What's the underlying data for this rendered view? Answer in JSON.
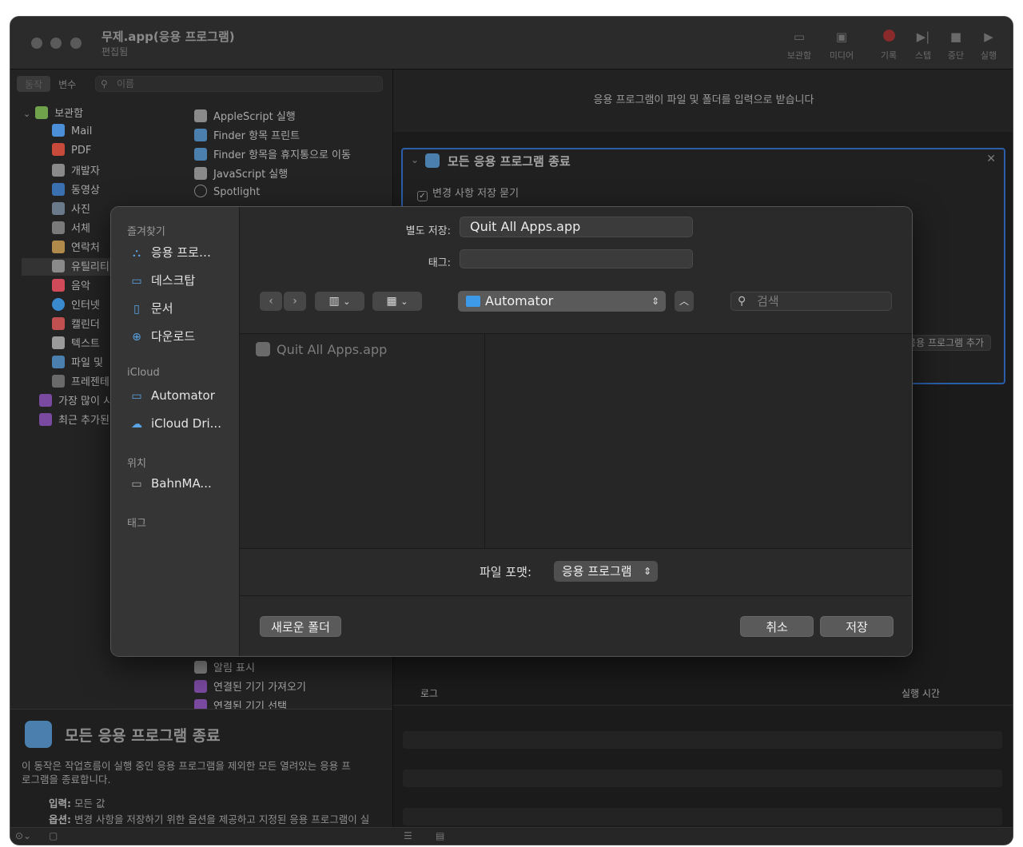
{
  "window": {
    "title": "무제.app(응용 프로그램)",
    "subtitle": "편집됨",
    "toolbar": [
      "보관함",
      "미디어",
      "기록",
      "스텝",
      "중단",
      "실행"
    ]
  },
  "library": {
    "tabs": [
      "동작",
      "변수"
    ],
    "search_placeholder": "이름",
    "items": [
      {
        "label": "보관함",
        "color": "#6fa24b"
      },
      {
        "label": "Mail",
        "color": "#4a8fd8"
      },
      {
        "label": "PDF",
        "color": "#c84a3a"
      },
      {
        "label": "개발자",
        "color": "#8a8a8a"
      },
      {
        "label": "동영상",
        "color": "#3a6fb0"
      },
      {
        "label": "사진",
        "color": "#6a7a8a"
      },
      {
        "label": "서체",
        "color": "#7a7a7a"
      },
      {
        "label": "연락처",
        "color": "#b08a4a"
      },
      {
        "label": "유틸리티",
        "color": "#8a8a8a"
      },
      {
        "label": "음악",
        "color": "#d04a5a"
      },
      {
        "label": "인터넷",
        "color": "#3a8ad0"
      },
      {
        "label": "캘린더",
        "color": "#c05050"
      },
      {
        "label": "텍스트",
        "color": "#9a9a9a"
      },
      {
        "label": "파일 및",
        "color": "#4a7fae"
      },
      {
        "label": "프레젠테",
        "color": "#6a6a6a"
      },
      {
        "label": "가장 많이 시",
        "color": "#7a4aa0"
      },
      {
        "label": "최근 추가된",
        "color": "#7a4aa0"
      }
    ],
    "actions_top": [
      "AppleScript 실행",
      "Finder 항목 프린트",
      "Finder 항목을 휴지통으로 이동",
      "JavaScript 실행",
      "Spotlight"
    ],
    "actions_bottom": [
      "알림 표시",
      "연결된 기기 가져오기",
      "연결된 기기 선택"
    ]
  },
  "description": {
    "title": "모든 응용 프로그램 종료",
    "text": "이 동작은 작업흐름이 실행 중인 응용 프로그램을 제외한 모든 열려있는 응용 프로그램을 종료합니다.",
    "input_label": "입력:",
    "input_value": "모든 값",
    "options_label": "옵션:",
    "options_value": "변경 사항을 저장하기 위한 옵션을 제공하고 지정된 응용 프로그램이 실"
  },
  "workflow": {
    "banner": "응용 프로그램이 파일 및 폴더를 입력으로 받습니다",
    "action_title": "모든 응용 프로그램 종료",
    "checkbox_label": "변경 사항 저장 묻기",
    "add_app_button": "응용 프로그램 추가",
    "log_col": "로그",
    "time_col": "실행 시간"
  },
  "dialog": {
    "save_as_label": "별도 저장:",
    "save_as_value": "Quit All Apps.app",
    "tags_label": "태그:",
    "tags_value": "",
    "location": "Automator",
    "search_placeholder": "검색",
    "sidebar": {
      "favorites_header": "즐겨찾기",
      "favorites": [
        "응용 프로…",
        "데스크탑",
        "문서",
        "다운로드"
      ],
      "icloud_header": "iCloud",
      "icloud": [
        "Automator",
        "iCloud Dri..."
      ],
      "locations_header": "위치",
      "locations": [
        "BahnMA..."
      ],
      "tags_header": "태그"
    },
    "file": "Quit All Apps.app",
    "format_label": "파일 포맷:",
    "format_value": "응용 프로그램",
    "new_folder": "새로운 폴더",
    "cancel": "취소",
    "save": "저장"
  }
}
